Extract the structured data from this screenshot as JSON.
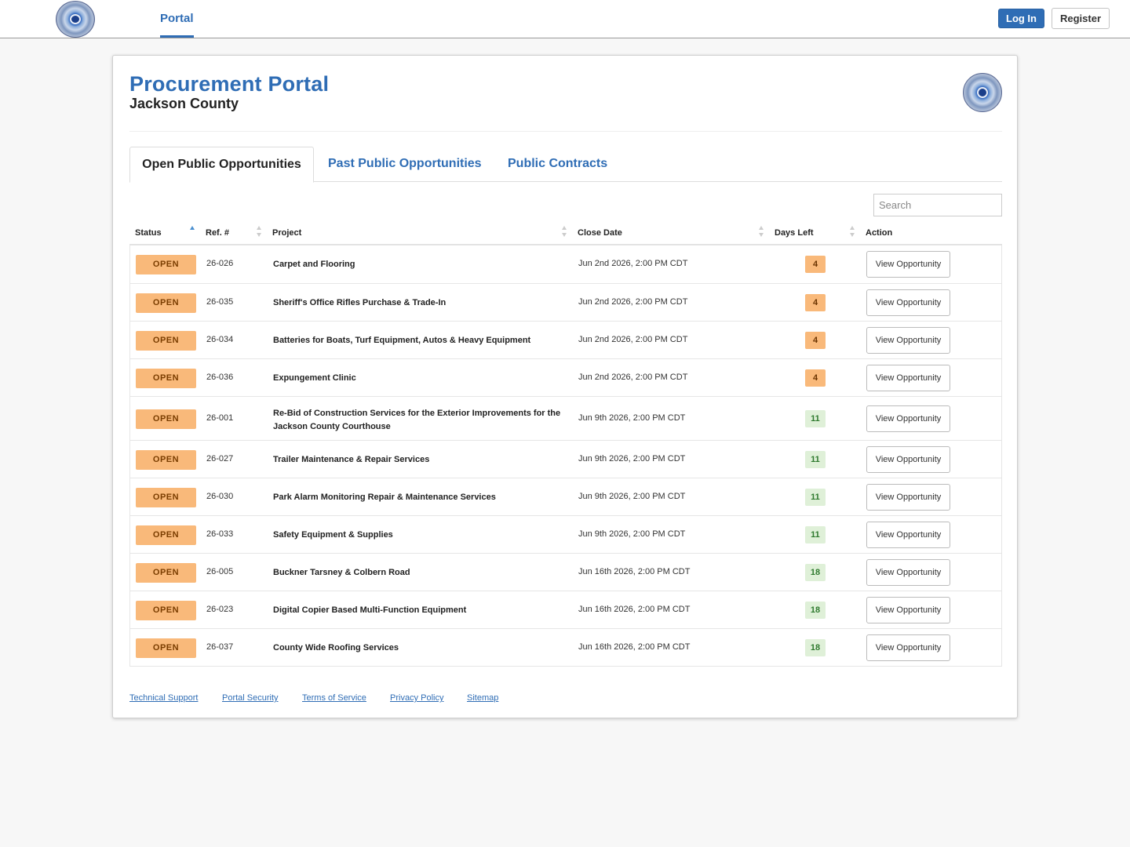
{
  "topbar": {
    "nav_portal": "Portal",
    "login_label": "Log In",
    "register_label": "Register"
  },
  "header": {
    "title": "Procurement Portal",
    "subtitle": "Jackson County"
  },
  "tabs": [
    {
      "label": "Open Public Opportunities",
      "active": true
    },
    {
      "label": "Past Public Opportunities",
      "active": false
    },
    {
      "label": "Public Contracts",
      "active": false
    }
  ],
  "search": {
    "placeholder": "Search",
    "value": ""
  },
  "table": {
    "columns": [
      "Status",
      "Ref. #",
      "Project",
      "Close Date",
      "Days Left",
      "Action"
    ],
    "sort": {
      "column": "Status",
      "direction": "ascending"
    },
    "rows": [
      {
        "status": "OPEN",
        "ref": "26-026",
        "project": "Carpet and Flooring",
        "close": "Jun 2nd 2026, 2:00 PM CDT",
        "days": "4",
        "days_level": "orange",
        "action": "View Opportunity"
      },
      {
        "status": "OPEN",
        "ref": "26-035",
        "project": "Sheriff's Office Rifles Purchase & Trade-In",
        "close": "Jun 2nd 2026, 2:00 PM CDT",
        "days": "4",
        "days_level": "orange",
        "action": "View Opportunity"
      },
      {
        "status": "OPEN",
        "ref": "26-034",
        "project": "Batteries for Boats, Turf Equipment, Autos & Heavy Equipment",
        "close": "Jun 2nd 2026, 2:00 PM CDT",
        "days": "4",
        "days_level": "orange",
        "action": "View Opportunity"
      },
      {
        "status": "OPEN",
        "ref": "26-036",
        "project": "Expungement Clinic",
        "close": "Jun 2nd 2026, 2:00 PM CDT",
        "days": "4",
        "days_level": "orange",
        "action": "View Opportunity"
      },
      {
        "status": "OPEN",
        "ref": "26-001",
        "project": "Re-Bid of Construction Services for the Exterior Improvements for the Jackson County Courthouse",
        "close": "Jun 9th 2026, 2:00 PM CDT",
        "days": "11",
        "days_level": "green",
        "action": "View Opportunity"
      },
      {
        "status": "OPEN",
        "ref": "26-027",
        "project": "Trailer Maintenance & Repair Services",
        "close": "Jun 9th 2026, 2:00 PM CDT",
        "days": "11",
        "days_level": "green",
        "action": "View Opportunity"
      },
      {
        "status": "OPEN",
        "ref": "26-030",
        "project": "Park Alarm Monitoring Repair & Maintenance Services",
        "close": "Jun 9th 2026, 2:00 PM CDT",
        "days": "11",
        "days_level": "green",
        "action": "View Opportunity"
      },
      {
        "status": "OPEN",
        "ref": "26-033",
        "project": "Safety Equipment & Supplies",
        "close": "Jun 9th 2026, 2:00 PM CDT",
        "days": "11",
        "days_level": "green",
        "action": "View Opportunity"
      },
      {
        "status": "OPEN",
        "ref": "26-005",
        "project": "Buckner Tarsney & Colbern Road",
        "close": "Jun 16th 2026, 2:00 PM CDT",
        "days": "18",
        "days_level": "green",
        "action": "View Opportunity"
      },
      {
        "status": "OPEN",
        "ref": "26-023",
        "project": "Digital Copier Based Multi-Function Equipment",
        "close": "Jun 16th 2026, 2:00 PM CDT",
        "days": "18",
        "days_level": "green",
        "action": "View Opportunity"
      },
      {
        "status": "OPEN",
        "ref": "26-037",
        "project": "County Wide Roofing Services",
        "close": "Jun 16th 2026, 2:00 PM CDT",
        "days": "18",
        "days_level": "green",
        "action": "View Opportunity"
      }
    ]
  },
  "footer": {
    "links": [
      "Technical Support",
      "Portal Security",
      "Terms of Service",
      "Privacy Policy",
      "Sitemap"
    ]
  },
  "colors": {
    "brand_blue": "#2f6db5",
    "status_open": "#f9b97a",
    "days_urgent": "#f9b97a",
    "days_ok": "#dff0d8"
  },
  "icons": {
    "county_seal": "county-seal-icon",
    "sort_arrows": "sort-arrows-icon"
  }
}
